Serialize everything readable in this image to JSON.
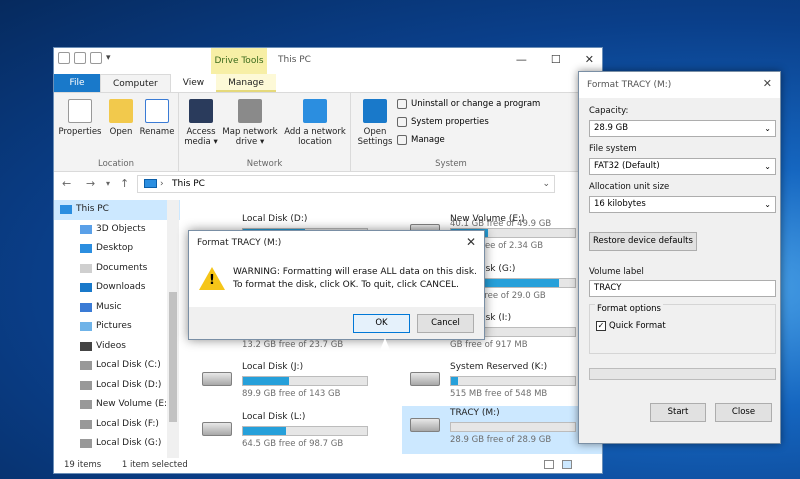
{
  "explorer": {
    "title": "This PC",
    "drive_tools": "Drive Tools",
    "tabs": [
      "File",
      "Computer",
      "View",
      "Manage"
    ],
    "ribbon": {
      "location": {
        "label": "Location",
        "buttons": [
          "Properties",
          "Open",
          "Rename"
        ]
      },
      "network": {
        "label": "Network",
        "buttons": [
          "Access\nmedia ▾",
          "Map network\ndrive ▾",
          "Add a network\nlocation"
        ]
      },
      "system": {
        "label": "System",
        "open_settings": "Open\nSettings",
        "items": [
          "Uninstall or change a program",
          "System properties",
          "Manage"
        ]
      }
    },
    "address": "This PC",
    "nav": [
      "This PC",
      "3D Objects",
      "Desktop",
      "Documents",
      "Downloads",
      "Music",
      "Pictures",
      "Videos",
      "Local Disk (C:)",
      "Local Disk (D:)",
      "New Volume (E:)",
      "Local Disk (F:)",
      "Local Disk (G:)"
    ],
    "drives": [
      {
        "name": "",
        "free": "40.1 GB free of 49.9 GB",
        "fill": 0.2
      },
      {
        "name": "Local Disk (D:)",
        "free": "",
        "fill": 0.5
      },
      {
        "name": "New Volume (E:)",
        "free": "33 GB free of 2.34 GB",
        "fill": 0.3
      },
      {
        "name": "",
        "free": "",
        "fill": 0.0
      },
      {
        "name": "Local Disk (G:)",
        "free": "3.7 GB free of 29.0 GB",
        "fill": 0.87
      },
      {
        "name": "",
        "free": "13.2 GB free of 23.7 GB",
        "fill": 0.44
      },
      {
        "name": "Local Disk (I:)",
        "free": "GB free of 917 MB",
        "fill": 0.25
      },
      {
        "name": "Local Disk (J:)",
        "free": "89.9 GB free of 143 GB",
        "fill": 0.37
      },
      {
        "name": "System Reserved (K:)",
        "free": "515 MB free of 548 MB",
        "fill": 0.06
      },
      {
        "name": "Local Disk (L:)",
        "free": "64.5 GB free of 98.7 GB",
        "fill": 0.35
      },
      {
        "name": "TRACY (M:)",
        "free": "28.9 GB free of 28.9 GB",
        "fill": 0.0
      }
    ],
    "status": {
      "items": "19 items",
      "selected": "1 item selected"
    }
  },
  "format": {
    "title": "Format TRACY (M:)",
    "capacity_label": "Capacity:",
    "capacity": "28.9 GB",
    "fs_label": "File system",
    "fs": "FAT32 (Default)",
    "alloc_label": "Allocation unit size",
    "alloc": "16 kilobytes",
    "restore": "Restore device defaults",
    "volume_label": "Volume label",
    "volume": "TRACY",
    "options_label": "Format options",
    "quick": "Quick Format",
    "start": "Start",
    "close": "Close"
  },
  "warning": {
    "title": "Format TRACY (M:)",
    "line1": "WARNING: Formatting will erase ALL data on this disk.",
    "line2": "To format the disk, click OK. To quit, click CANCEL.",
    "ok": "OK",
    "cancel": "Cancel"
  }
}
